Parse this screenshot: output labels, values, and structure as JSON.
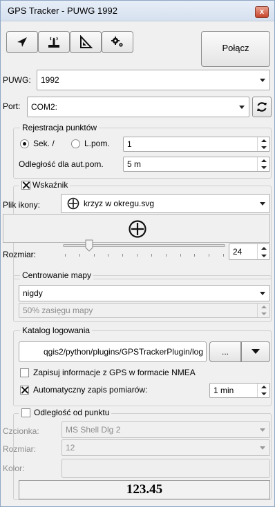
{
  "window": {
    "title": "GPS Tracker - PUWG 1992",
    "close_glyph": "x"
  },
  "toolbar": {
    "icons": [
      "navigation-arrow-icon",
      "gps-antenna-icon",
      "triangle-ruler-icon",
      "gears-icon"
    ],
    "connect_label": "Połącz"
  },
  "puwg": {
    "label": "PUWG:",
    "value": "1992"
  },
  "port": {
    "label": "Port:",
    "value": "COM2:",
    "refresh_icon": "refresh-icon"
  },
  "registration": {
    "title": "Rejestracja punktów",
    "mode_sec": "Sek. /",
    "mode_point": "L.pom.",
    "selected": "sec",
    "interval_value": "1",
    "distance_label": "Odległość dla aut.pom.",
    "distance_value": "5 m"
  },
  "indicator": {
    "enabled": true,
    "title": "Wskaźnik",
    "icon_file_label": "Plik ikony:",
    "icon_file_value": "krzyz w okregu.svg",
    "size_label": "Rozmiar:",
    "size_value": "24",
    "slider_fraction": 0.16
  },
  "centering": {
    "title": "Centrowanie mapy",
    "mode_value": "nigdy",
    "range_value": "50% zasięgu mapy"
  },
  "logging": {
    "title": "Katalog logowania",
    "path_value": "qgis2/python/plugins/GPSTrackerPlugin/log",
    "browse_label": "...",
    "nmea_label": "Zapisuj informacje z GPS w formacie NMEA",
    "nmea_checked": false,
    "autosave_label": "Automatyczny zapis pomiarów:",
    "autosave_checked": true,
    "autosave_value": "1 min"
  },
  "distance": {
    "title": "Odległość od punktu",
    "enabled": false,
    "font_label": "Czcionka:",
    "font_value": "MS Shell Dlg 2",
    "size_label": "Rozmiar:",
    "size_value": "12",
    "color_label": "Kolor:",
    "display_value": "123.45"
  },
  "colors": {
    "accent": "#dbe6f4",
    "close": "#c7452b"
  }
}
